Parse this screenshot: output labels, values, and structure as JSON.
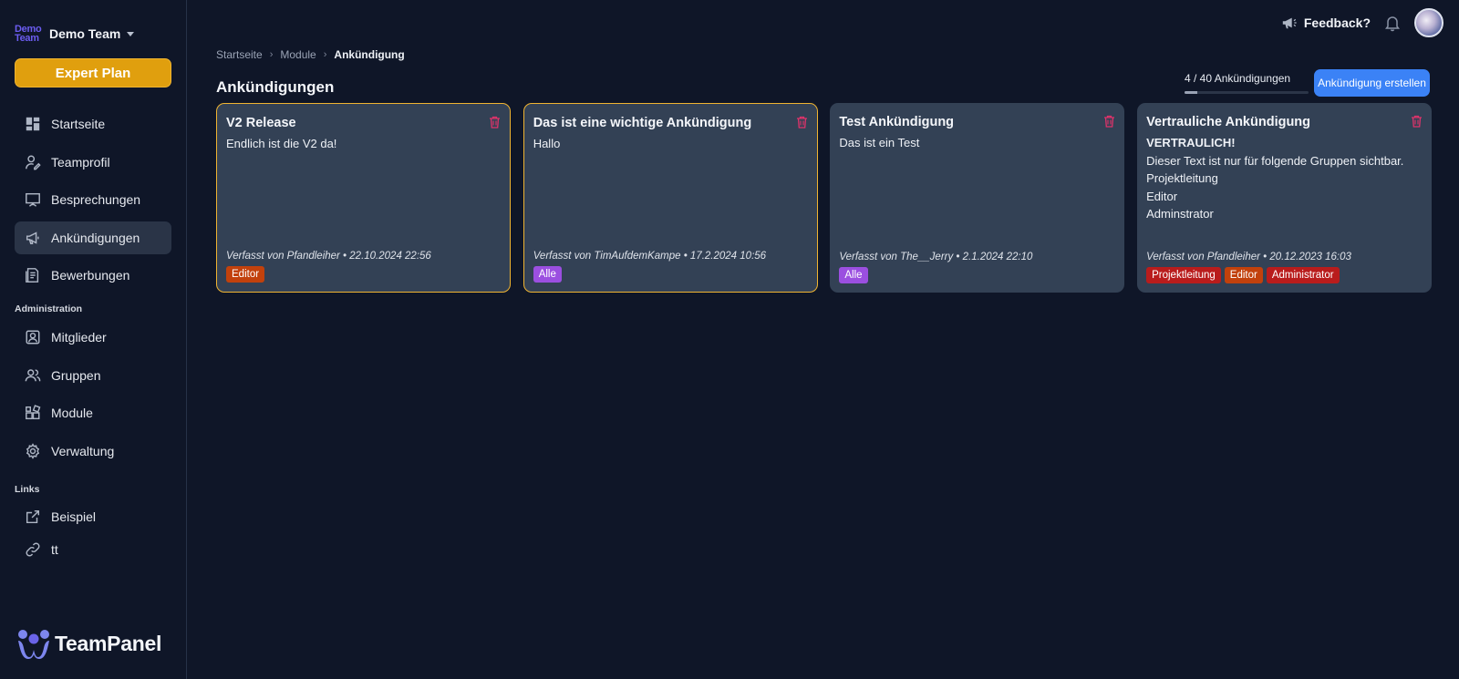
{
  "team": {
    "logo_line1": "Demo",
    "logo_line2": "Team",
    "name": "Demo Team"
  },
  "plan_button": "Expert Plan",
  "nav": [
    {
      "label": "Startseite",
      "icon": "dashboard-icon"
    },
    {
      "label": "Teamprofil",
      "icon": "user-edit-icon"
    },
    {
      "label": "Besprechungen",
      "icon": "presentation-icon"
    },
    {
      "label": "Ankündigungen",
      "icon": "megaphone-icon",
      "active": true
    },
    {
      "label": "Bewerbungen",
      "icon": "application-icon"
    }
  ],
  "admin_section": "Administration",
  "admin_nav": [
    {
      "label": "Mitglieder",
      "icon": "member-card-icon"
    },
    {
      "label": "Gruppen",
      "icon": "users-icon"
    },
    {
      "label": "Module",
      "icon": "modules-icon"
    },
    {
      "label": "Verwaltung",
      "icon": "gear-icon"
    }
  ],
  "links_section": "Links",
  "links": [
    {
      "label": "Beispiel",
      "icon": "external-link-icon"
    },
    {
      "label": "tt",
      "icon": "link-icon"
    }
  ],
  "brand": "TeamPanel",
  "header": {
    "feedback": "Feedback?"
  },
  "breadcrumb": {
    "home": "Startseite",
    "section": "Module",
    "current": "Ankündigung"
  },
  "page_title": "Ankündigungen",
  "counter": {
    "text": "4 / 40 Ankündigungen",
    "current": 4,
    "max": 40
  },
  "create_button": "Ankündigung erstellen",
  "colors": {
    "accent": "#3b82f6",
    "plan": "#e09f0e",
    "card": "#334155",
    "important_border": "#f0b431"
  },
  "announcements": [
    {
      "title": "V2 Release",
      "lines": [
        "Endlich ist die V2 da!"
      ],
      "meta": "Verfasst von Pfandleiher • 22.10.2024 22:56",
      "important": true,
      "tags": [
        {
          "label": "Editor",
          "color": "#c2410c"
        }
      ]
    },
    {
      "title": "Das ist eine wichtige Ankündigung",
      "lines": [
        "Hallo"
      ],
      "meta": "Verfasst von TimAufdemKampe • 17.2.2024 10:56",
      "important": true,
      "tags": [
        {
          "label": "Alle",
          "color": "#9b4fe0"
        }
      ]
    },
    {
      "title": "Test Ankündigung",
      "lines": [
        "Das ist ein Test"
      ],
      "meta": "Verfasst von The__Jerry • 2.1.2024 22:10",
      "important": false,
      "tags": [
        {
          "label": "Alle",
          "color": "#9b4fe0"
        }
      ]
    },
    {
      "title": "Vertrauliche Ankündigung",
      "strong_line": "VERTRAULICH!",
      "lines": [
        "Dieser Text ist nur für folgende Gruppen sichtbar.",
        "Projektleitung",
        "Editor",
        "Adminstrator"
      ],
      "meta": "Verfasst von Pfandleiher • 20.12.2023 16:03",
      "important": false,
      "tags": [
        {
          "label": "Projektleitung",
          "color": "#b91c1c"
        },
        {
          "label": "Editor",
          "color": "#c2410c"
        },
        {
          "label": "Administrator",
          "color": "#b91c1c"
        }
      ]
    }
  ]
}
